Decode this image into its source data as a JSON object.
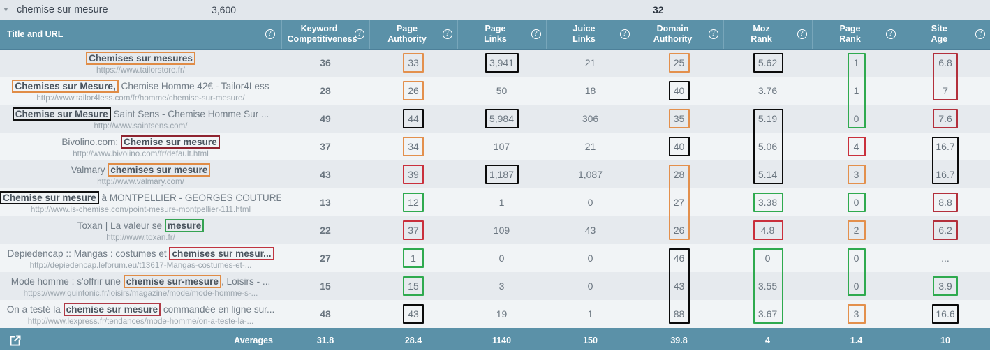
{
  "topbar": {
    "caret_icon": "caret-down-icon",
    "keyword": "chemise sur mesure",
    "volume": "3,600",
    "difficulty": "32"
  },
  "columns": [
    {
      "key": "title",
      "label_line1": "Title and URL",
      "label_line2": "",
      "help": "?"
    },
    {
      "key": "kc",
      "label_line1": "Keyword",
      "label_line2": "Competitiveness",
      "help": "?"
    },
    {
      "key": "pa",
      "label_line1": "Page",
      "label_line2": "Authority",
      "help": "?"
    },
    {
      "key": "plinks",
      "label_line1": "Page",
      "label_line2": "Links",
      "help": "?"
    },
    {
      "key": "jlinks",
      "label_line1": "Juice",
      "label_line2": "Links",
      "help": "?"
    },
    {
      "key": "da",
      "label_line1": "Domain",
      "label_line2": "Authority",
      "help": "?"
    },
    {
      "key": "moz",
      "label_line1": "Moz",
      "label_line2": "Rank",
      "help": "?"
    },
    {
      "key": "pr",
      "label_line1": "Page",
      "label_line2": "Rank",
      "help": "?"
    },
    {
      "key": "age",
      "label_line1": "Site",
      "label_line2": "Age",
      "help": "?"
    }
  ],
  "rows": [
    {
      "title_parts": [
        {
          "text": "Chemises sur mesures",
          "highlight": "orange"
        }
      ],
      "url": "https://www.tailorstore.fr/",
      "kc": "36",
      "pa": "33",
      "plinks": "3,941",
      "jlinks": "21",
      "da": "25",
      "moz": "5.62",
      "pr": "1",
      "age": "6.8"
    },
    {
      "title_parts": [
        {
          "text": "Chemises sur Mesure,",
          "highlight": "orange"
        },
        {
          "text": " Chemise Homme 42€ - Tailor4Less",
          "highlight": "none"
        }
      ],
      "url": "http://www.tailor4less.com/fr/homme/chemise-sur-mesure/",
      "kc": "28",
      "pa": "26",
      "plinks": "50",
      "jlinks": "18",
      "da": "40",
      "moz": "3.76",
      "pr": "1",
      "age": "7"
    },
    {
      "title_parts": [
        {
          "text": "Chemise sur Mesure",
          "highlight": "black"
        },
        {
          "text": " Saint Sens - Chemise Homme Sur ...",
          "highlight": "none"
        }
      ],
      "url": "http://www.saintsens.com/",
      "kc": "49",
      "pa": "44",
      "plinks": "5,984",
      "jlinks": "306",
      "da": "35",
      "moz": "5.19",
      "pr": "0",
      "age": "7.6"
    },
    {
      "title_parts": [
        {
          "text": "Bivolino.com: ",
          "highlight": "none"
        },
        {
          "text": "Chemise sur mesure",
          "highlight": "red"
        }
      ],
      "url": "http://www.bivolino.com/fr/default.html",
      "kc": "37",
      "pa": "34",
      "plinks": "107",
      "jlinks": "21",
      "da": "40",
      "moz": "5.06",
      "pr": "4",
      "age": "16.7"
    },
    {
      "title_parts": [
        {
          "text": "Valmary ",
          "highlight": "none"
        },
        {
          "text": "chemises sur mesure",
          "highlight": "orange"
        }
      ],
      "url": "http://www.valmary.com/",
      "kc": "43",
      "pa": "39",
      "plinks": "1,187",
      "jlinks": "1,087",
      "da": "28",
      "moz": "5.14",
      "pr": "3",
      "age": "16.7"
    },
    {
      "title_parts": [
        {
          "text": "Chemise sur mesure",
          "highlight": "black"
        },
        {
          "text": " à MONTPELLIER - GEORGES COUTURE",
          "highlight": "none"
        }
      ],
      "url": "http://www.is-chemise.com/point-mesure-montpellier-111.html",
      "kc": "13",
      "pa": "12",
      "plinks": "1",
      "jlinks": "0",
      "da": "27",
      "moz": "3.38",
      "pr": "0",
      "age": "8.8"
    },
    {
      "title_parts": [
        {
          "text": "Toxan | La valeur se ",
          "highlight": "none"
        },
        {
          "text": "mesure",
          "highlight": "green"
        }
      ],
      "url": "http://www.toxan.fr/",
      "kc": "22",
      "pa": "37",
      "plinks": "109",
      "jlinks": "43",
      "da": "26",
      "moz": "4.8",
      "pr": "2",
      "age": "6.2"
    },
    {
      "title_parts": [
        {
          "text": "Depiedencap :: Mangas : costumes et ",
          "highlight": "none"
        },
        {
          "text": "chemises sur mesur...",
          "highlight": "red2"
        }
      ],
      "url": "http://depiedencap.leforum.eu/t13617-Mangas-costumes-et-...",
      "kc": "27",
      "pa": "1",
      "plinks": "0",
      "jlinks": "0",
      "da": "46",
      "moz": "0",
      "pr": "0",
      "age": "..."
    },
    {
      "title_parts": [
        {
          "text": "Mode homme : s'offrir une ",
          "highlight": "none"
        },
        {
          "text": "chemise sur-mesure",
          "highlight": "orange"
        },
        {
          "text": ", Loisirs - ...",
          "highlight": "none"
        }
      ],
      "url": "https://www.quintonic.fr/loisirs/magazine/mode/mode-homme-s-...",
      "kc": "15",
      "pa": "15",
      "plinks": "3",
      "jlinks": "0",
      "da": "43",
      "moz": "3.55",
      "pr": "0",
      "age": "3.9"
    },
    {
      "title_parts": [
        {
          "text": "On a testé la ",
          "highlight": "none"
        },
        {
          "text": "chemise sur mesure",
          "highlight": "redl"
        },
        {
          "text": " commandée en ligne sur...",
          "highlight": "none"
        }
      ],
      "url": "http://www.lexpress.fr/tendances/mode-homme/on-a-teste-la-...",
      "kc": "48",
      "pa": "43",
      "plinks": "19",
      "jlinks": "1",
      "da": "88",
      "moz": "3.67",
      "pr": "3",
      "age": "16.6"
    }
  ],
  "footer": {
    "export_icon": "external-link-icon",
    "label": "Averages",
    "values": {
      "kc": "31.8",
      "pa": "28.4",
      "plinks": "1140",
      "jlinks": "150",
      "da": "39.8",
      "moz": "4",
      "pr": "1.4",
      "age": "10"
    }
  },
  "colors": {
    "header_bg": "#5b91a8",
    "row_odd": "#e6eaee",
    "row_even": "#f1f4f6",
    "topbar_bg": "#e2e7ec",
    "box_orange": "#e3904d",
    "box_black": "#0b0b0b",
    "box_red": "#c9303c",
    "box_green": "#2faa4f"
  }
}
